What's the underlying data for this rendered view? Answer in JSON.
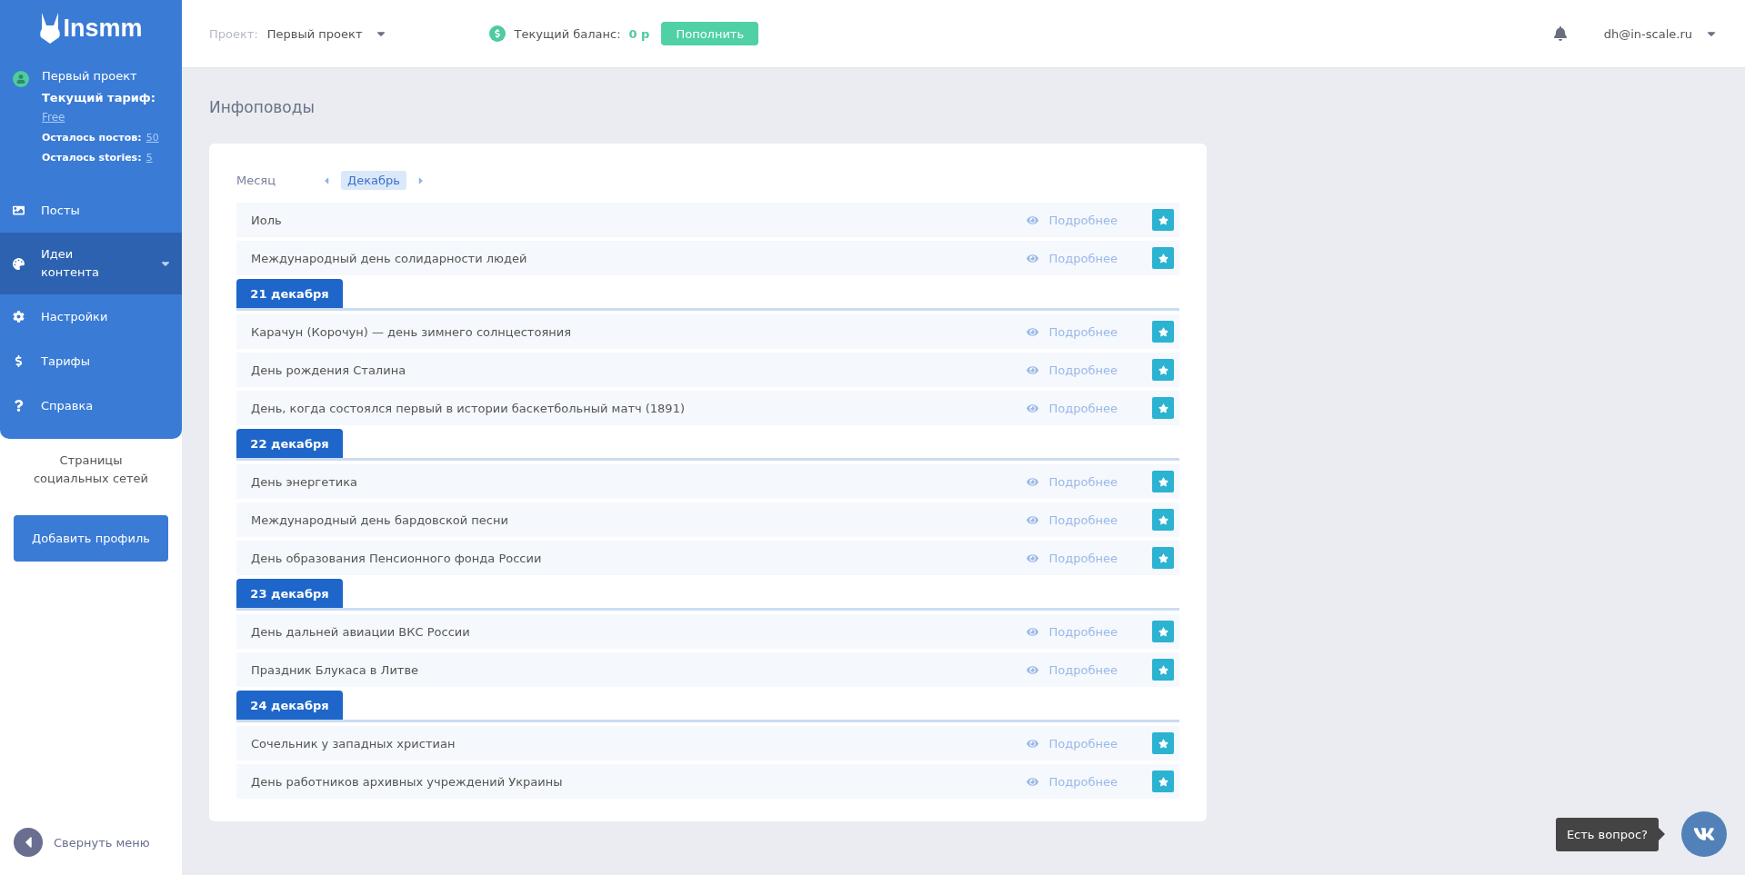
{
  "sidebar": {
    "logo": "Insmm",
    "project": {
      "name": "Первый проект",
      "tariff_label": "Текущий тариф:",
      "tariff": "Free",
      "posts_label": "Осталось постов:",
      "posts": "50",
      "stories_label": "Осталось stories:",
      "stories": "5"
    },
    "nav": [
      {
        "label": "Посты",
        "selected": false,
        "expandable": false
      },
      {
        "label": "Идеи контента",
        "selected": true,
        "expandable": true
      },
      {
        "label": "Настройки",
        "selected": false,
        "expandable": false
      },
      {
        "label": "Тарифы",
        "selected": false,
        "expandable": false
      },
      {
        "label": "Справка",
        "selected": false,
        "expandable": false
      }
    ],
    "social_title": "Страницы социальных сетей",
    "add_button": "Добавить профиль",
    "collapse": "Свернуть меню"
  },
  "header": {
    "project_label": "Проект:",
    "project": "Первый проект",
    "balance_label": "Текущий баланс:",
    "balance": "0 р",
    "topup_button": "Пополнить",
    "user": "dh@in-scale.ru"
  },
  "page_title": "Инфоповоды",
  "calendar": {
    "period_label": "Месяц",
    "month": "Декабрь",
    "entries": [
      {
        "kind": "event",
        "title": "Иоль",
        "link": "Подробнее"
      },
      {
        "kind": "event",
        "title": "Международный день солидарности людей",
        "link": "Подробнее"
      },
      {
        "kind": "date",
        "title": "21 декабря"
      },
      {
        "kind": "event",
        "title": "Карачун (Корочун) — день зимнего солнцестояния",
        "link": "Подробнее"
      },
      {
        "kind": "event",
        "title": "День рождения Сталина",
        "link": "Подробнее"
      },
      {
        "kind": "event",
        "title": "День, когда состоялся первый в истории баскетбольный матч (1891)",
        "link": "Подробнее"
      },
      {
        "kind": "date",
        "title": "22 декабря"
      },
      {
        "kind": "event",
        "title": "День энергетика",
        "link": "Подробнее"
      },
      {
        "kind": "event",
        "title": "Международный день бардовской песни",
        "link": "Подробнее"
      },
      {
        "kind": "event",
        "title": "День образования Пенсионного фонда России",
        "link": "Подробнее"
      },
      {
        "kind": "date",
        "title": "23 декабря"
      },
      {
        "kind": "event",
        "title": "День дальней авиации ВКС России",
        "link": "Подробнее"
      },
      {
        "kind": "event",
        "title": "Праздник Блукаса в Литве",
        "link": "Подробнее"
      },
      {
        "kind": "date",
        "title": "24 декабря"
      },
      {
        "kind": "event",
        "title": "Сочельник у западных христиан",
        "link": "Подробнее"
      },
      {
        "kind": "event",
        "title": "День работников архивных учреждений Украины",
        "link": "Подробнее"
      }
    ]
  },
  "chat_widget": {
    "tooltip": "Есть вопрос?"
  }
}
